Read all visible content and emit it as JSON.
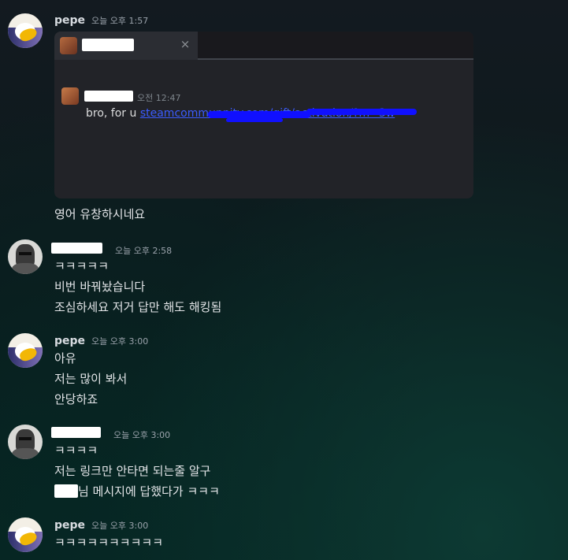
{
  "messages": [
    {
      "author": "pepe",
      "timestamp": "오늘 오후 1:57",
      "embed": {
        "close_icon": "×",
        "quoted_timestamp": "오전 12:47",
        "quoted_text_prefix": "bro, for u ",
        "quoted_link": "steamcommunnity.com/gift/activation/?m=3w"
      },
      "lines": [
        "영어 유창하시네요"
      ]
    },
    {
      "author": "",
      "timestamp": "오늘 오후 2:58",
      "lines": [
        "ㅋㅋㅋㅋㅋ",
        "비번 바꿔놨습니다",
        "조심하세요 저거 답만 해도 해킹됨"
      ]
    },
    {
      "author": "pepe",
      "timestamp": "오늘 오후 3:00",
      "lines": [
        "아유",
        "저는 많이 봐서",
        "안당하죠"
      ]
    },
    {
      "author": "",
      "timestamp": "오늘 오후 3:00",
      "lines": [
        "ㅋㅋㅋㅋ",
        "저는 링크만 안타면 되는줄 알구",
        "님 메시지에 답했다가 ㅋㅋㅋ"
      ]
    },
    {
      "author": "pepe",
      "timestamp": "오늘 오후 3:00",
      "lines": [
        "ㅋㅋㅋㅋㅋㅋㅋㅋㅋㅋ"
      ]
    }
  ],
  "colors": {
    "username": "#d7dbe0",
    "timestamp": "#9aa2ab",
    "message_text": "#e3e5e8",
    "embed_bg": "#222328",
    "link": "#3b5cff"
  },
  "icons": {
    "close": "close-icon",
    "avatar_pepe": "pepe-avatar",
    "avatar_knight": "knight-avatar"
  }
}
